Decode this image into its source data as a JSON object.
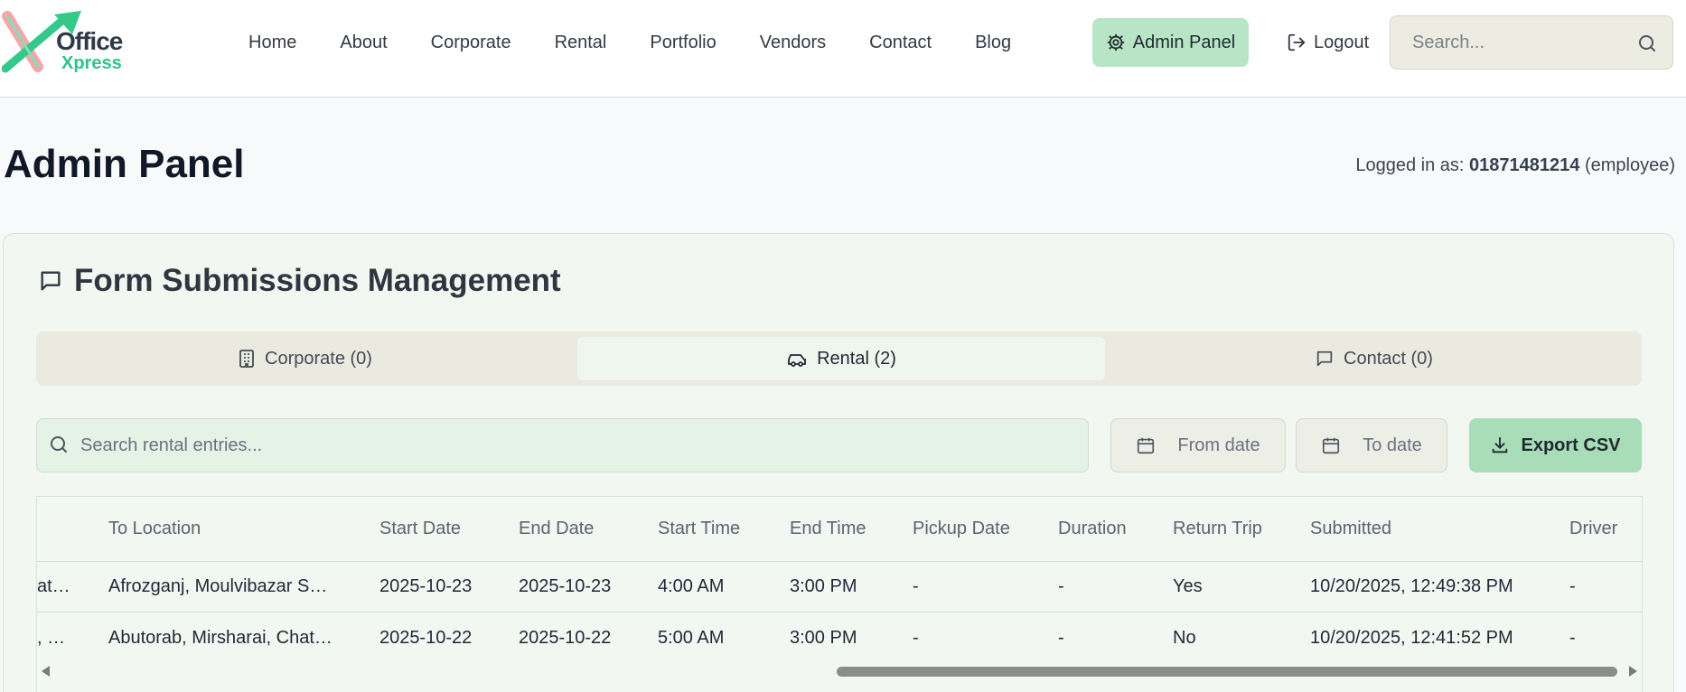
{
  "header": {
    "logo_text_top": "Office",
    "logo_text_bottom": "Xpress",
    "nav": [
      "Home",
      "About",
      "Corporate",
      "Rental",
      "Portfolio",
      "Vendors",
      "Contact",
      "Blog"
    ],
    "admin_label": "Admin Panel",
    "logout_label": "Logout",
    "search_placeholder": "Search..."
  },
  "page": {
    "title": "Admin Panel",
    "logged_in_prefix": "Logged in as: ",
    "user": "01871481214",
    "role": "(employee)"
  },
  "card": {
    "title": "Form Submissions Management",
    "tabs": [
      {
        "label": "Corporate (0)",
        "icon": "building-icon",
        "active": false
      },
      {
        "label": "Rental (2)",
        "icon": "car-icon",
        "active": true
      },
      {
        "label": "Contact (0)",
        "icon": "message-icon",
        "active": false
      }
    ],
    "search_placeholder": "Search rental entries...",
    "from_date": "From date",
    "to_date": "To date",
    "export_label": "Export CSV"
  },
  "table": {
    "columns": [
      "To Location",
      "Start Date",
      "End Date",
      "Start Time",
      "End Time",
      "Pickup Date",
      "Duration",
      "Return Trip",
      "Submitted",
      "Driver"
    ],
    "rows": [
      {
        "partial": "at…",
        "cells": [
          "Afrozganj, Moulvibazar S…",
          "2025-10-23",
          "2025-10-23",
          "4:00 AM",
          "3:00 PM",
          "-",
          "-",
          "Yes",
          "10/20/2025, 12:49:38 PM",
          "-"
        ]
      },
      {
        "partial": ", …",
        "cells": [
          "Abutorab, Mirsharai, Chat…",
          "2025-10-22",
          "2025-10-22",
          "5:00 AM",
          "3:00 PM",
          "-",
          "-",
          "No",
          "10/20/2025, 12:41:52 PM",
          "-"
        ]
      }
    ]
  },
  "colors": {
    "accent": "#b8e5c6",
    "export": "#a9dcb8",
    "background": "#f8f9fa",
    "card": "#f2f7f2"
  }
}
